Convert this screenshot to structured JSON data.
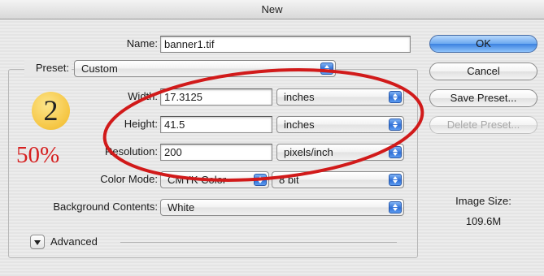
{
  "window": {
    "title": "New"
  },
  "name": {
    "label": "Name:",
    "value": "banner1.tif"
  },
  "preset": {
    "label": "Preset:",
    "value": "Custom"
  },
  "width": {
    "label": "Width:",
    "value": "17.3125",
    "unit": "inches"
  },
  "height": {
    "label": "Height:",
    "value": "41.5",
    "unit": "inches"
  },
  "resolution": {
    "label": "Resolution:",
    "value": "200",
    "unit": "pixels/inch"
  },
  "color_mode": {
    "label": "Color Mode:",
    "value": "CMYK Color",
    "depth": "8 bit"
  },
  "background": {
    "label": "Background Contents:",
    "value": "White"
  },
  "advanced": {
    "label": "Advanced"
  },
  "buttons": {
    "ok": "OK",
    "cancel": "Cancel",
    "save_preset": "Save Preset...",
    "delete_preset": "Delete Preset..."
  },
  "image_size": {
    "label": "Image Size:",
    "value": "109.6M"
  },
  "annotations": {
    "badge": "2",
    "percent": "50%",
    "circle_color": "#d11a1a"
  }
}
